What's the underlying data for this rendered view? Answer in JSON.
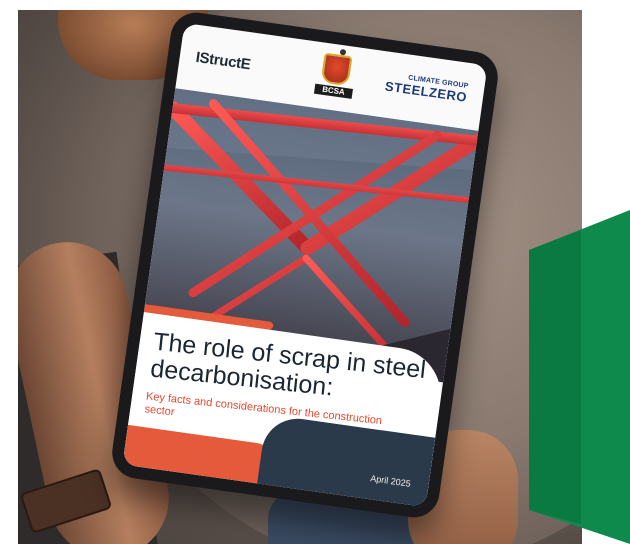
{
  "image": {
    "kind": "photo of hands holding a tablet showing a report cover",
    "brand_colors": {
      "green": "#0f8a4d",
      "orange": "#e45a3b",
      "navy": "#1b2633",
      "bridge_red": "#e03a3a"
    }
  },
  "tablet": {
    "logos": {
      "istructe": "IStructE",
      "bcsa": "BCSA",
      "steelzero_top": "CLIMATE GROUP",
      "steelzero_main": "STEELZERO"
    },
    "cover": {
      "title": "The role of scrap in steel decarbonisation:",
      "subtitle": "Key facts and considerations for the construction sector",
      "date": "April 2025"
    }
  }
}
